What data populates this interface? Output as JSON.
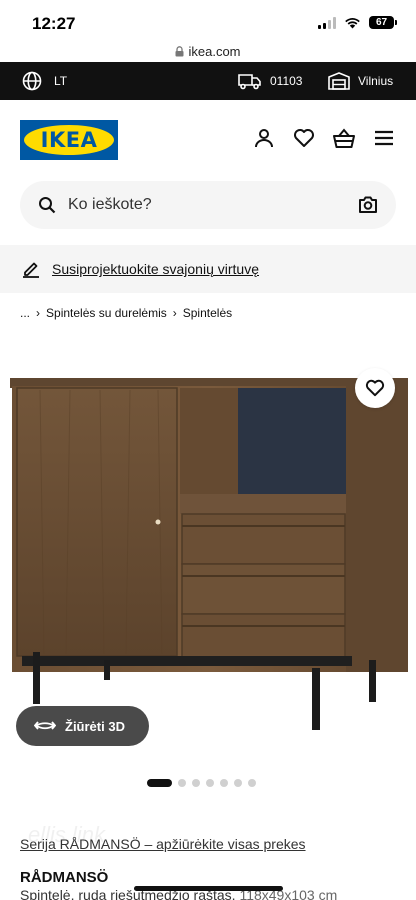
{
  "status_bar": {
    "time": "12:27",
    "battery": "67"
  },
  "browser": {
    "url": "ikea.com"
  },
  "top_strip": {
    "language": "LT",
    "postal_code": "01103",
    "store": "Vilnius"
  },
  "brand": {
    "logo_text": "IKEA",
    "blue": "#0058a3",
    "yellow": "#ffdb00"
  },
  "header": {
    "icons": [
      "user-icon",
      "heart-icon",
      "basket-icon",
      "menu-icon"
    ]
  },
  "search": {
    "placeholder": "Ko ieškote?"
  },
  "promo": {
    "text": "Susiprojektuokite svajonių virtuvę"
  },
  "breadcrumb": {
    "ellipsis": "...",
    "items": [
      "Spintelės su durelėmis",
      "Spintelės"
    ]
  },
  "media": {
    "view_3d_label": "Žiūrėti 3D",
    "image_count": 7,
    "active_index": 0
  },
  "product": {
    "watermark": "ellis.link",
    "series_link": "Serija RÅDMANSÖ – apžiūrėkite visas prekes",
    "name": "RÅDMANSÖ",
    "description": "Spintelė, ruda riešutmedžio raštas,",
    "dimensions": "118x49x103 cm"
  }
}
